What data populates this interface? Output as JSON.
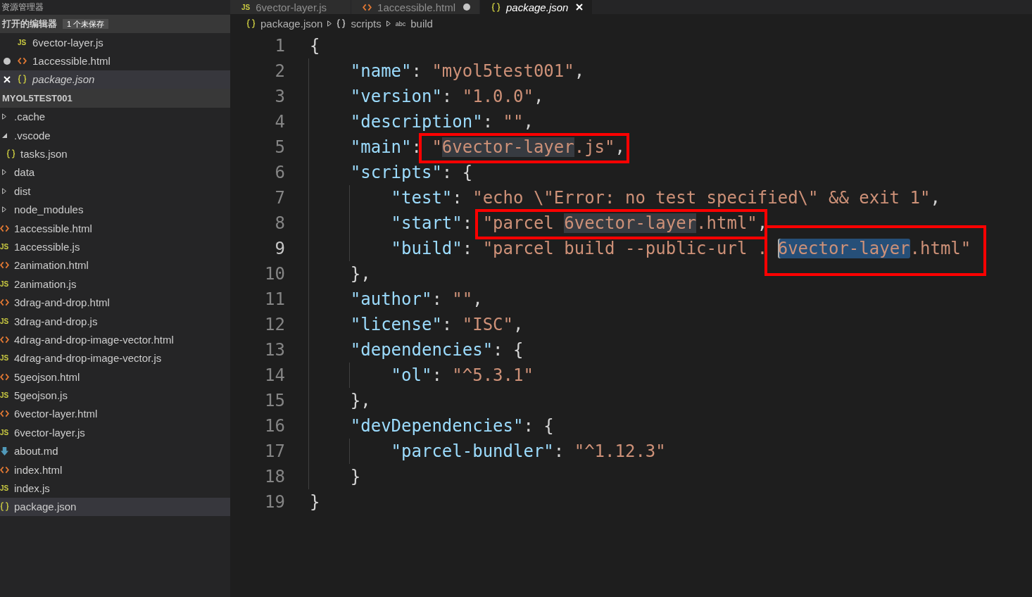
{
  "sidebar": {
    "title": "资源管理器",
    "open_editors": {
      "title": "打开的编辑器",
      "badge": "1 个未保存",
      "items": [
        {
          "kind": "js",
          "icon": "JS",
          "name": "6vector-layer.js",
          "dirty": false,
          "selected": false,
          "preview": false
        },
        {
          "kind": "html",
          "name": "1accessible.html",
          "dirty": true,
          "selected": false,
          "preview": false
        },
        {
          "kind": "json",
          "name": "package.json",
          "dirty": false,
          "selected": true,
          "preview": true
        }
      ]
    },
    "folder": {
      "title": "MYOL5TEST001",
      "items": [
        {
          "kind": "folder",
          "name": ".cache",
          "expanded": false,
          "selected": false
        },
        {
          "kind": "folder",
          "name": ".vscode",
          "expanded": true,
          "selected": false,
          "children": [
            {
              "kind": "json",
              "name": "tasks.json",
              "selected": false
            }
          ]
        },
        {
          "kind": "folder",
          "name": "data",
          "expanded": false,
          "selected": false
        },
        {
          "kind": "folder",
          "name": "dist",
          "expanded": false,
          "selected": false
        },
        {
          "kind": "folder",
          "name": "node_modules",
          "expanded": false,
          "selected": false
        },
        {
          "kind": "html",
          "name": "1accessible.html",
          "selected": false
        },
        {
          "kind": "js",
          "icon": "JS",
          "name": "1accessible.js",
          "selected": false
        },
        {
          "kind": "html",
          "name": "2animation.html",
          "selected": false
        },
        {
          "kind": "js",
          "icon": "JS",
          "name": "2animation.js",
          "selected": false
        },
        {
          "kind": "html",
          "name": "3drag-and-drop.html",
          "selected": false
        },
        {
          "kind": "js",
          "icon": "JS",
          "name": "3drag-and-drop.js",
          "selected": false
        },
        {
          "kind": "html",
          "name": "4drag-and-drop-image-vector.html",
          "selected": false
        },
        {
          "kind": "js",
          "icon": "JS",
          "name": "4drag-and-drop-image-vector.js",
          "selected": false
        },
        {
          "kind": "html",
          "name": "5geojson.html",
          "selected": false
        },
        {
          "kind": "js",
          "icon": "JS",
          "name": "5geojson.js",
          "selected": false
        },
        {
          "kind": "html",
          "name": "6vector-layer.html",
          "selected": false
        },
        {
          "kind": "js",
          "icon": "JS",
          "name": "6vector-layer.js",
          "selected": false
        },
        {
          "kind": "md",
          "name": "about.md",
          "selected": false
        },
        {
          "kind": "html",
          "name": "index.html",
          "selected": false
        },
        {
          "kind": "js",
          "icon": "JS",
          "name": "index.js",
          "selected": false
        },
        {
          "kind": "json",
          "name": "package.json",
          "selected": true
        }
      ]
    }
  },
  "tabs": [
    {
      "kind": "js",
      "icon": "JS",
      "label": "6vector-layer.js",
      "selected": false,
      "dirty": false,
      "preview": false
    },
    {
      "kind": "html",
      "label": "1accessible.html",
      "selected": false,
      "dirty": true,
      "preview": false
    },
    {
      "kind": "json",
      "label": "package.json",
      "selected": true,
      "dirty": false,
      "preview": true
    }
  ],
  "breadcrumb": [
    {
      "kind": "json",
      "label": "package.json"
    },
    {
      "kind": "object",
      "label": "scripts"
    },
    {
      "kind": "string",
      "icon": "abc",
      "label": "build"
    }
  ],
  "editor": {
    "lines": [
      {
        "n": "1",
        "current": false,
        "tokens": [
          {
            "kind": "punct",
            "text": "{"
          }
        ],
        "children": [
          {
            "n": "2",
            "current": false,
            "tokens": [
              {
                "kind": "key",
                "text": "\"name\""
              },
              {
                "kind": "punct",
                "text": ": "
              },
              {
                "kind": "string",
                "text": "\"myol5test001\""
              },
              {
                "kind": "punct",
                "text": ","
              }
            ]
          },
          {
            "n": "3",
            "current": false,
            "tokens": [
              {
                "kind": "key",
                "text": "\"version\""
              },
              {
                "kind": "punct",
                "text": ": "
              },
              {
                "kind": "string",
                "text": "\"1.0.0\""
              },
              {
                "kind": "punct",
                "text": ","
              }
            ]
          },
          {
            "n": "4",
            "current": false,
            "tokens": [
              {
                "kind": "key",
                "text": "\"description\""
              },
              {
                "kind": "punct",
                "text": ": "
              },
              {
                "kind": "string",
                "text": "\"\""
              },
              {
                "kind": "punct",
                "text": ","
              }
            ]
          },
          {
            "n": "5",
            "current": false,
            "tokens": [
              {
                "kind": "key",
                "text": "\"main\""
              },
              {
                "kind": "punct",
                "text": ": "
              },
              {
                "kind": "string",
                "text": "\""
              },
              {
                "kind": "string",
                "text": "6vector-layer",
                "occurrence": true
              },
              {
                "kind": "string",
                "text": ".js\""
              },
              {
                "kind": "punct",
                "text": ","
              }
            ]
          },
          {
            "n": "6",
            "current": false,
            "tokens": [
              {
                "kind": "key",
                "text": "\"scripts\""
              },
              {
                "kind": "punct",
                "text": ": {"
              }
            ],
            "children": [
              {
                "n": "7",
                "current": false,
                "tokens": [
                  {
                    "kind": "key",
                    "text": "\"test\""
                  },
                  {
                    "kind": "punct",
                    "text": ": "
                  },
                  {
                    "kind": "string",
                    "text": "\"echo \\\"Error: no test specified\\\" && exit 1\""
                  },
                  {
                    "kind": "punct",
                    "text": ","
                  }
                ]
              },
              {
                "n": "8",
                "current": false,
                "tokens": [
                  {
                    "kind": "key",
                    "text": "\"start\""
                  },
                  {
                    "kind": "punct",
                    "text": ": "
                  },
                  {
                    "kind": "string",
                    "text": "\"parcel "
                  },
                  {
                    "kind": "string",
                    "text": "6vector-layer",
                    "occurrence": true
                  },
                  {
                    "kind": "string",
                    "text": ".html\""
                  },
                  {
                    "kind": "punct",
                    "text": ","
                  }
                ]
              },
              {
                "n": "9",
                "current": true,
                "tokens": [
                  {
                    "kind": "key",
                    "text": "\"build\""
                  },
                  {
                    "kind": "punct",
                    "text": ": "
                  },
                  {
                    "kind": "string",
                    "text": "\"parcel build --public-url . "
                  },
                  {
                    "kind": "string",
                    "text": "6vector-layer",
                    "selected": true,
                    "cursor": true
                  },
                  {
                    "kind": "string",
                    "text": ".html\""
                  }
                ]
              }
            ]
          },
          {
            "n": "10",
            "current": false,
            "tokens": [
              {
                "kind": "punct",
                "text": "},"
              }
            ]
          },
          {
            "n": "11",
            "current": false,
            "tokens": [
              {
                "kind": "key",
                "text": "\"author\""
              },
              {
                "kind": "punct",
                "text": ": "
              },
              {
                "kind": "string",
                "text": "\"\""
              },
              {
                "kind": "punct",
                "text": ","
              }
            ]
          },
          {
            "n": "12",
            "current": false,
            "tokens": [
              {
                "kind": "key",
                "text": "\"license\""
              },
              {
                "kind": "punct",
                "text": ": "
              },
              {
                "kind": "string",
                "text": "\"ISC\""
              },
              {
                "kind": "punct",
                "text": ","
              }
            ]
          },
          {
            "n": "13",
            "current": false,
            "tokens": [
              {
                "kind": "key",
                "text": "\"dependencies\""
              },
              {
                "kind": "punct",
                "text": ": {"
              }
            ],
            "children": [
              {
                "n": "14",
                "current": false,
                "tokens": [
                  {
                    "kind": "key",
                    "text": "\"ol\""
                  },
                  {
                    "kind": "punct",
                    "text": ": "
                  },
                  {
                    "kind": "string",
                    "text": "\"^5.3.1\""
                  }
                ]
              }
            ]
          },
          {
            "n": "15",
            "current": false,
            "tokens": [
              {
                "kind": "punct",
                "text": "},"
              }
            ]
          },
          {
            "n": "16",
            "current": false,
            "tokens": [
              {
                "kind": "key",
                "text": "\"devDependencies\""
              },
              {
                "kind": "punct",
                "text": ": {"
              }
            ],
            "children": [
              {
                "n": "17",
                "current": false,
                "tokens": [
                  {
                    "kind": "key",
                    "text": "\"parcel-bundler\""
                  },
                  {
                    "kind": "punct",
                    "text": ": "
                  },
                  {
                    "kind": "string",
                    "text": "\"^1.12.3\""
                  }
                ]
              }
            ]
          },
          {
            "n": "18",
            "current": false,
            "tokens": [
              {
                "kind": "punct",
                "text": "}"
              }
            ]
          }
        ]
      },
      {
        "n": "19",
        "current": false,
        "tokens": [
          {
            "kind": "punct",
            "text": "}"
          }
        ]
      }
    ]
  }
}
